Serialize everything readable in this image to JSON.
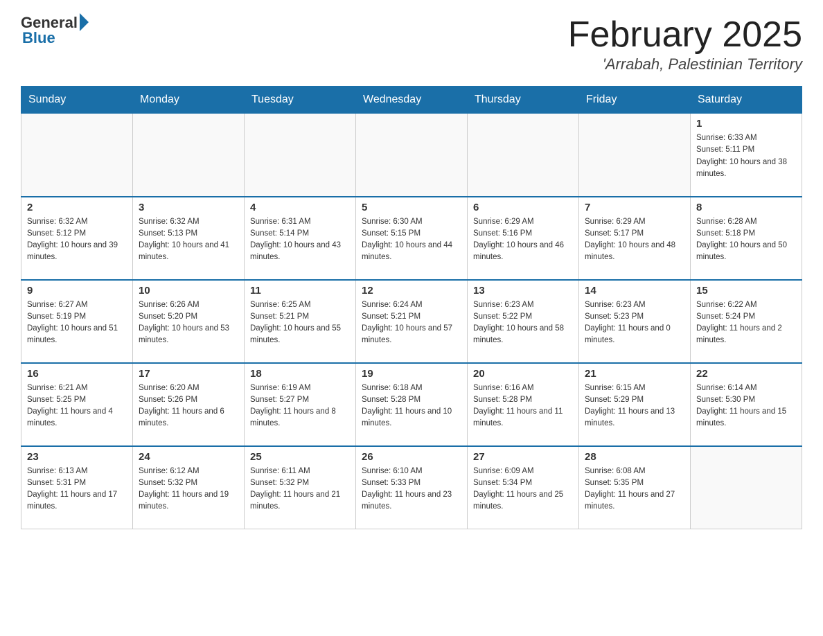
{
  "header": {
    "logo_general": "General",
    "logo_blue": "Blue",
    "title": "February 2025",
    "location": "'Arrabah, Palestinian Territory"
  },
  "days_of_week": [
    "Sunday",
    "Monday",
    "Tuesday",
    "Wednesday",
    "Thursday",
    "Friday",
    "Saturday"
  ],
  "weeks": [
    [
      {
        "day": "",
        "sunrise": "",
        "sunset": "",
        "daylight": ""
      },
      {
        "day": "",
        "sunrise": "",
        "sunset": "",
        "daylight": ""
      },
      {
        "day": "",
        "sunrise": "",
        "sunset": "",
        "daylight": ""
      },
      {
        "day": "",
        "sunrise": "",
        "sunset": "",
        "daylight": ""
      },
      {
        "day": "",
        "sunrise": "",
        "sunset": "",
        "daylight": ""
      },
      {
        "day": "",
        "sunrise": "",
        "sunset": "",
        "daylight": ""
      },
      {
        "day": "1",
        "sunrise": "Sunrise: 6:33 AM",
        "sunset": "Sunset: 5:11 PM",
        "daylight": "Daylight: 10 hours and 38 minutes."
      }
    ],
    [
      {
        "day": "2",
        "sunrise": "Sunrise: 6:32 AM",
        "sunset": "Sunset: 5:12 PM",
        "daylight": "Daylight: 10 hours and 39 minutes."
      },
      {
        "day": "3",
        "sunrise": "Sunrise: 6:32 AM",
        "sunset": "Sunset: 5:13 PM",
        "daylight": "Daylight: 10 hours and 41 minutes."
      },
      {
        "day": "4",
        "sunrise": "Sunrise: 6:31 AM",
        "sunset": "Sunset: 5:14 PM",
        "daylight": "Daylight: 10 hours and 43 minutes."
      },
      {
        "day": "5",
        "sunrise": "Sunrise: 6:30 AM",
        "sunset": "Sunset: 5:15 PM",
        "daylight": "Daylight: 10 hours and 44 minutes."
      },
      {
        "day": "6",
        "sunrise": "Sunrise: 6:29 AM",
        "sunset": "Sunset: 5:16 PM",
        "daylight": "Daylight: 10 hours and 46 minutes."
      },
      {
        "day": "7",
        "sunrise": "Sunrise: 6:29 AM",
        "sunset": "Sunset: 5:17 PM",
        "daylight": "Daylight: 10 hours and 48 minutes."
      },
      {
        "day": "8",
        "sunrise": "Sunrise: 6:28 AM",
        "sunset": "Sunset: 5:18 PM",
        "daylight": "Daylight: 10 hours and 50 minutes."
      }
    ],
    [
      {
        "day": "9",
        "sunrise": "Sunrise: 6:27 AM",
        "sunset": "Sunset: 5:19 PM",
        "daylight": "Daylight: 10 hours and 51 minutes."
      },
      {
        "day": "10",
        "sunrise": "Sunrise: 6:26 AM",
        "sunset": "Sunset: 5:20 PM",
        "daylight": "Daylight: 10 hours and 53 minutes."
      },
      {
        "day": "11",
        "sunrise": "Sunrise: 6:25 AM",
        "sunset": "Sunset: 5:21 PM",
        "daylight": "Daylight: 10 hours and 55 minutes."
      },
      {
        "day": "12",
        "sunrise": "Sunrise: 6:24 AM",
        "sunset": "Sunset: 5:21 PM",
        "daylight": "Daylight: 10 hours and 57 minutes."
      },
      {
        "day": "13",
        "sunrise": "Sunrise: 6:23 AM",
        "sunset": "Sunset: 5:22 PM",
        "daylight": "Daylight: 10 hours and 58 minutes."
      },
      {
        "day": "14",
        "sunrise": "Sunrise: 6:23 AM",
        "sunset": "Sunset: 5:23 PM",
        "daylight": "Daylight: 11 hours and 0 minutes."
      },
      {
        "day": "15",
        "sunrise": "Sunrise: 6:22 AM",
        "sunset": "Sunset: 5:24 PM",
        "daylight": "Daylight: 11 hours and 2 minutes."
      }
    ],
    [
      {
        "day": "16",
        "sunrise": "Sunrise: 6:21 AM",
        "sunset": "Sunset: 5:25 PM",
        "daylight": "Daylight: 11 hours and 4 minutes."
      },
      {
        "day": "17",
        "sunrise": "Sunrise: 6:20 AM",
        "sunset": "Sunset: 5:26 PM",
        "daylight": "Daylight: 11 hours and 6 minutes."
      },
      {
        "day": "18",
        "sunrise": "Sunrise: 6:19 AM",
        "sunset": "Sunset: 5:27 PM",
        "daylight": "Daylight: 11 hours and 8 minutes."
      },
      {
        "day": "19",
        "sunrise": "Sunrise: 6:18 AM",
        "sunset": "Sunset: 5:28 PM",
        "daylight": "Daylight: 11 hours and 10 minutes."
      },
      {
        "day": "20",
        "sunrise": "Sunrise: 6:16 AM",
        "sunset": "Sunset: 5:28 PM",
        "daylight": "Daylight: 11 hours and 11 minutes."
      },
      {
        "day": "21",
        "sunrise": "Sunrise: 6:15 AM",
        "sunset": "Sunset: 5:29 PM",
        "daylight": "Daylight: 11 hours and 13 minutes."
      },
      {
        "day": "22",
        "sunrise": "Sunrise: 6:14 AM",
        "sunset": "Sunset: 5:30 PM",
        "daylight": "Daylight: 11 hours and 15 minutes."
      }
    ],
    [
      {
        "day": "23",
        "sunrise": "Sunrise: 6:13 AM",
        "sunset": "Sunset: 5:31 PM",
        "daylight": "Daylight: 11 hours and 17 minutes."
      },
      {
        "day": "24",
        "sunrise": "Sunrise: 6:12 AM",
        "sunset": "Sunset: 5:32 PM",
        "daylight": "Daylight: 11 hours and 19 minutes."
      },
      {
        "day": "25",
        "sunrise": "Sunrise: 6:11 AM",
        "sunset": "Sunset: 5:32 PM",
        "daylight": "Daylight: 11 hours and 21 minutes."
      },
      {
        "day": "26",
        "sunrise": "Sunrise: 6:10 AM",
        "sunset": "Sunset: 5:33 PM",
        "daylight": "Daylight: 11 hours and 23 minutes."
      },
      {
        "day": "27",
        "sunrise": "Sunrise: 6:09 AM",
        "sunset": "Sunset: 5:34 PM",
        "daylight": "Daylight: 11 hours and 25 minutes."
      },
      {
        "day": "28",
        "sunrise": "Sunrise: 6:08 AM",
        "sunset": "Sunset: 5:35 PM",
        "daylight": "Daylight: 11 hours and 27 minutes."
      },
      {
        "day": "",
        "sunrise": "",
        "sunset": "",
        "daylight": ""
      }
    ]
  ]
}
